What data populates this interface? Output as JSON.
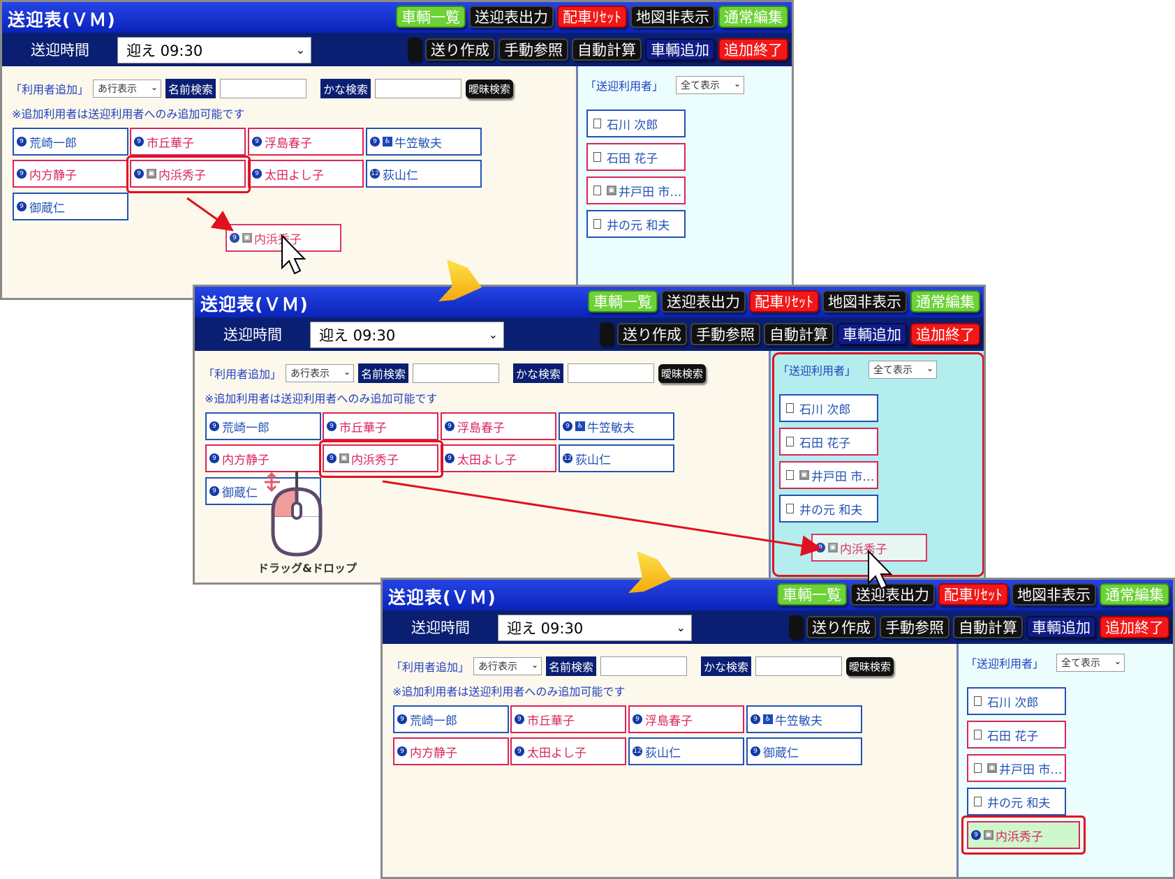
{
  "app": {
    "title": "送迎表(ＶＭ)"
  },
  "header_buttons": {
    "vehicle_list": "車輌一覧",
    "output": "送迎表出力",
    "reset": "配車ﾘｾｯﾄ",
    "map_hide": "地図非表示",
    "normal_edit": "通常編集"
  },
  "action_buttons": {
    "send_create": "送り作成",
    "manual_ref": "手動参照",
    "auto_calc": "自動計算",
    "add_vehicle": "車輌追加",
    "end_add": "追加終了"
  },
  "time": {
    "label": "送迎時間",
    "value": "迎え 09:30"
  },
  "search": {
    "add_label": "「利用者追加」",
    "row_filter": "あ行表示",
    "name_search": "名前検索",
    "kana_search": "かな検索",
    "fuzzy": "曖昧検索"
  },
  "note": "※追加利用者は送迎利用者へのみ追加可能です",
  "right_panel": {
    "label": "「送迎利用者」",
    "filter": "全て表示"
  },
  "users": {
    "arasaki": "荒崎一郎",
    "ichioka": "市丘華子",
    "ukishima": "浮島春子",
    "ushigasa": "牛笠敏夫",
    "uchikata": "内方静子",
    "uchihama": "内浜秀子",
    "ota": "太田よし子",
    "ogiyama": "荻山仁",
    "mikura": "御蔵仁",
    "num_9": "9",
    "num_12": "12",
    "chair_icon": "♿",
    "seat_icon": "▣"
  },
  "passengers": {
    "ishikawa": "石川 次郎",
    "ishida": "石田 花子",
    "idota": "井戸田 市…",
    "inomoto": "井の元 和夫"
  },
  "drag_drop_label": "ドラッグ&ドロップ",
  "colors": {
    "title_blue": "#0a23b8",
    "male": "#2252b4",
    "female": "#d9245a",
    "highlight": "#e0101e",
    "added_bg": "#cff7cc",
    "right_bg_active": "#b3eded"
  }
}
